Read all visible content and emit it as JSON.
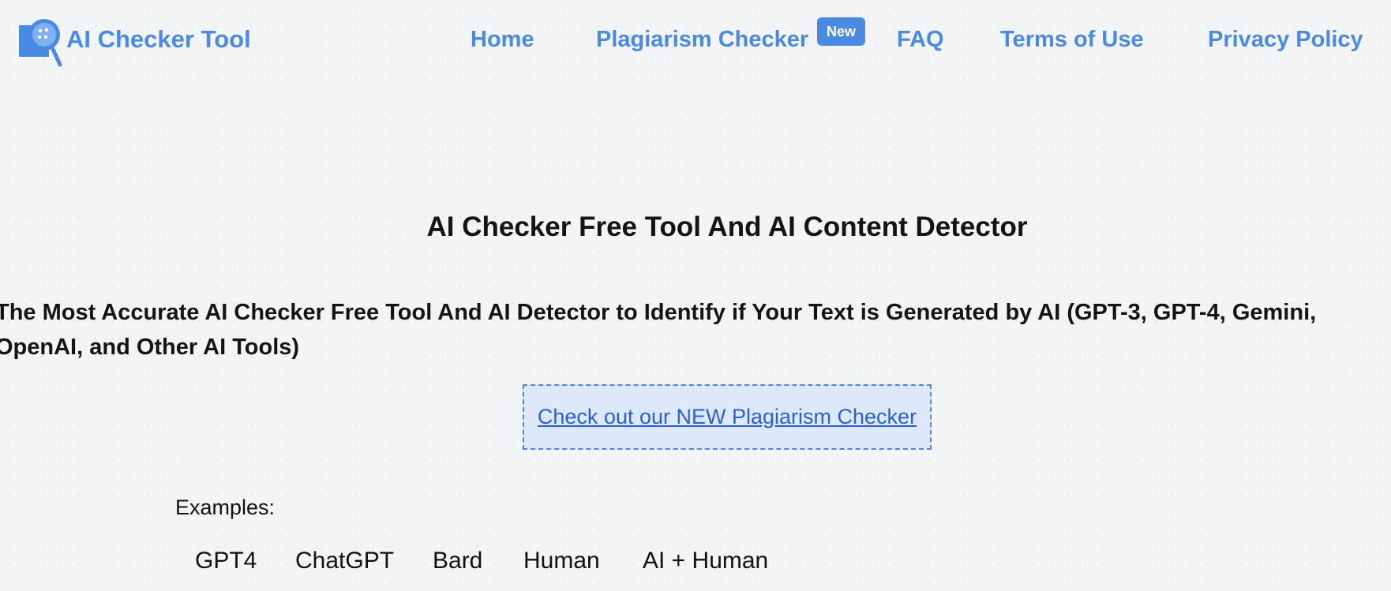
{
  "colors": {
    "brand": "#4a8ae2",
    "promo_background": "#dde9fb",
    "promo_border": "#4a86db",
    "promo_link": "#2b5fd1",
    "page_background": "#f3f4f6"
  },
  "header": {
    "brand_name": "AI Checker Tool",
    "logo_icon": "magnifier-document-icon",
    "nav": {
      "home": "Home",
      "plagiarism": "Plagiarism Checker",
      "plagiarism_badge": "New",
      "faq": "FAQ",
      "terms": "Terms of Use",
      "privacy": "Privacy Policy"
    }
  },
  "main": {
    "title": "AI Checker Free Tool And AI Content Detector",
    "subtitle": "The Most Accurate AI Checker Free Tool And AI Detector to Identify if Your Text is Generated by AI (GPT-3, GPT-4, Gemini, OpenAI, and Other AI Tools)",
    "promo_link": "Check out our NEW Plagiarism Checker",
    "examples_label": "Examples:",
    "examples": [
      "GPT4",
      "ChatGPT",
      "Bard",
      "Human",
      "AI + Human"
    ]
  }
}
